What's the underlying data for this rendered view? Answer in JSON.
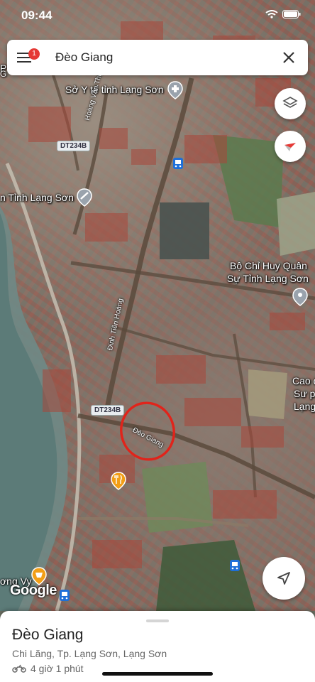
{
  "status": {
    "time": "09:44"
  },
  "search": {
    "query": "Đèo Giang",
    "notification_count": "1"
  },
  "map": {
    "labels": {
      "hospital": "Sở Y tế tỉnh Lạng Sơn",
      "province": "n Tỉnh Lạng Sơn",
      "military_line1": "Bộ Chỉ Huy Quân",
      "military_line2": "Sự Tỉnh Lạng Sơn",
      "cao_line1": "Cao đ",
      "cao_line2": "Sư p",
      "cao_line3": "Lạng",
      "vy": "ơng Vy",
      "edge_top": "P",
      "edge_top2": "G"
    },
    "roads": {
      "hoang_van_thu": "Hoàng Văn Thụ",
      "dinh_tien_hoang": "Đinh Tiên Hoàng",
      "deo_giang": "Đèo Giang",
      "dt234b_top": "DT234B",
      "dt234b_mid": "DT234B"
    },
    "highlight_color": "#e0241b"
  },
  "branding": {
    "logo": "Google"
  },
  "place": {
    "name": "Đèo Giang",
    "address": "Chi Lăng, Tp. Lạng Sơn, Lạng Sơn",
    "travel_time": "4 giờ 1 phút",
    "travel_mode_icon": "motorbike-icon"
  }
}
